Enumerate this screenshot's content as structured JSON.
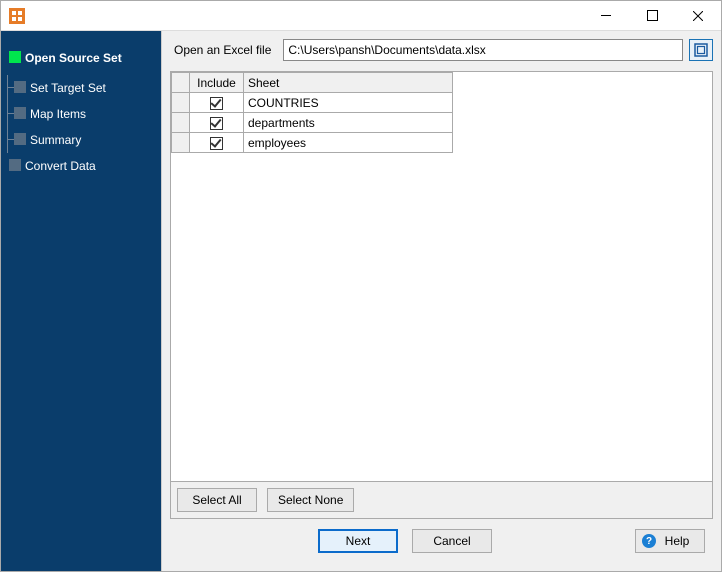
{
  "titlebar": {
    "title": ""
  },
  "sidebar": {
    "items": [
      {
        "label": "Open Source Set",
        "active": true,
        "children": [
          {
            "label": "Set Target Set"
          },
          {
            "label": "Map Items"
          },
          {
            "label": "Summary"
          }
        ]
      },
      {
        "label": "Convert Data"
      }
    ]
  },
  "main": {
    "open_label": "Open an Excel file",
    "file_path": "C:\\Users\\pansh\\Documents\\data.xlsx",
    "columns": {
      "include": "Include",
      "sheet": "Sheet"
    },
    "rows": [
      {
        "include": true,
        "sheet": "COUNTRIES"
      },
      {
        "include": true,
        "sheet": "departments"
      },
      {
        "include": true,
        "sheet": "employees"
      }
    ],
    "select_all": "Select All",
    "select_none": "Select None"
  },
  "footer": {
    "next": "Next",
    "cancel": "Cancel",
    "help": "Help"
  }
}
